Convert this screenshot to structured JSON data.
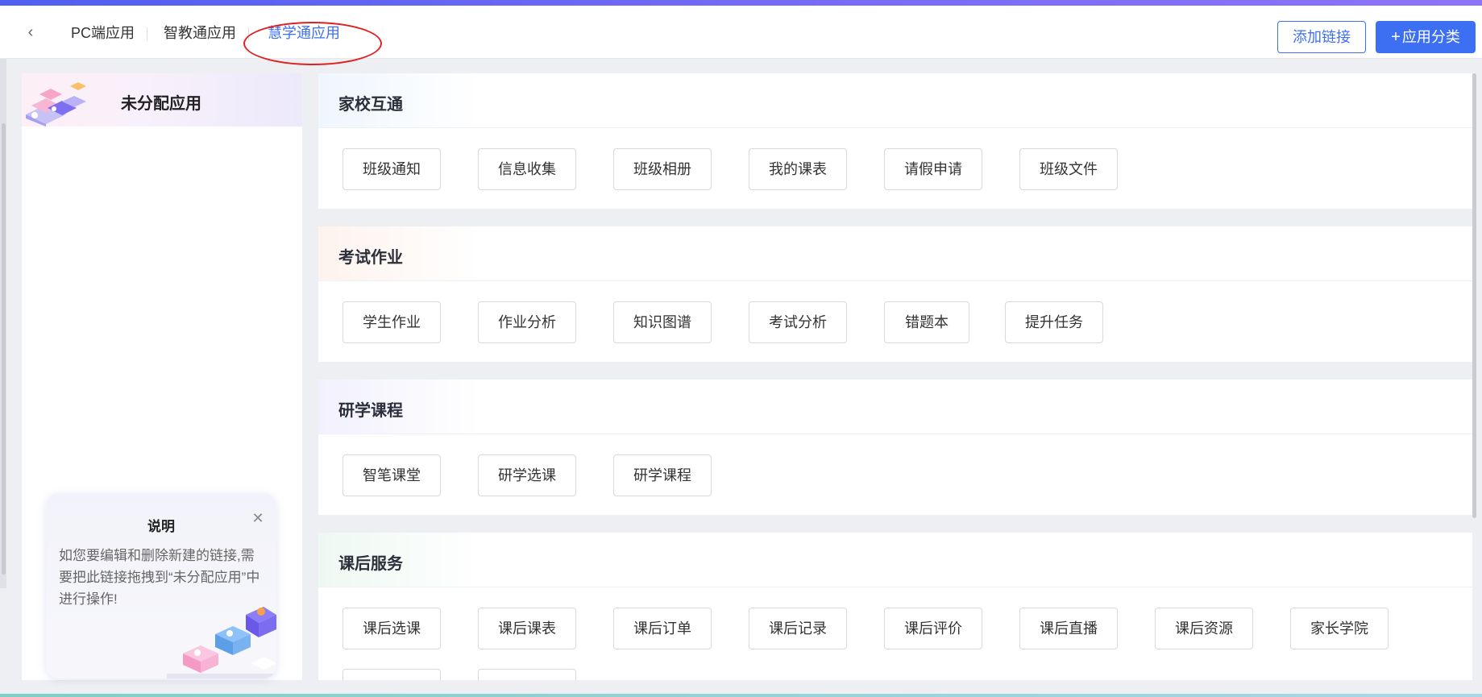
{
  "header": {
    "back_icon": "chevron-left-icon",
    "tabs": [
      {
        "label": "PC端应用"
      },
      {
        "label": "智教通应用"
      },
      {
        "label": "慧学通应用",
        "active": true
      }
    ],
    "add_link_label": "添加链接",
    "app_category_label": "应用分类",
    "add_icon": "plus-icon",
    "accent_color": "#3d6ff3"
  },
  "sidebar": {
    "title": "未分配应用",
    "note": {
      "title": "说明",
      "text": "如您要编辑和删除新建的链接,需要把此链接拖拽到“未分配应用”中进行操作!",
      "close_icon": "close-icon"
    }
  },
  "sections": [
    {
      "title": "家校互通",
      "apps": [
        "班级通知",
        "信息收集",
        "班级相册",
        "我的课表",
        "请假申请",
        "班级文件"
      ]
    },
    {
      "title": "考试作业",
      "apps": [
        "学生作业",
        "作业分析",
        "知识图谱",
        "考试分析",
        "错题本",
        "提升任务"
      ]
    },
    {
      "title": "研学课程",
      "apps": [
        "智笔课堂",
        "研学选课",
        "研学课程"
      ]
    },
    {
      "title": "课后服务",
      "apps": [
        "课后选课",
        "课后课表",
        "课后订单",
        "课后记录",
        "课后评价",
        "课后直播",
        "课后资源",
        "家长学院"
      ]
    }
  ]
}
